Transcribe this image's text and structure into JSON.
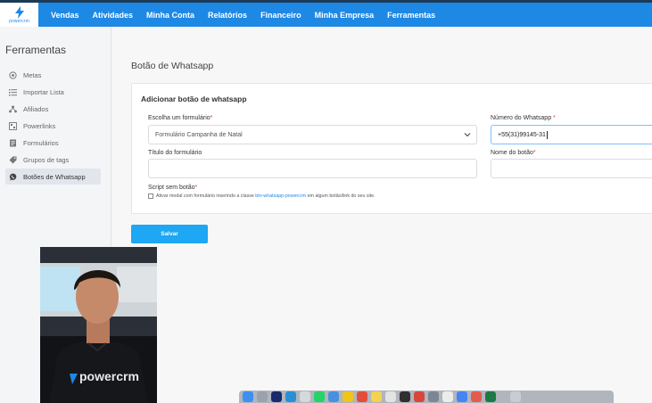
{
  "brand": {
    "logo_text": "powercrm"
  },
  "nav": [
    "Vendas",
    "Atividades",
    "Minha Conta",
    "Relatórios",
    "Financeiro",
    "Minha Empresa",
    "Ferramentas"
  ],
  "sidebar": {
    "title": "Ferramentas",
    "items": [
      {
        "label": "Metas",
        "icon": "target-icon",
        "active": false
      },
      {
        "label": "Importar Lista",
        "icon": "list-icon",
        "active": false
      },
      {
        "label": "Afiliados",
        "icon": "affiliates-icon",
        "active": false
      },
      {
        "label": "Powerlinks",
        "icon": "link-icon",
        "active": false
      },
      {
        "label": "Formulários",
        "icon": "form-icon",
        "active": false
      },
      {
        "label": "Grupos de tags",
        "icon": "tag-icon",
        "active": false
      },
      {
        "label": "Botões de Whatsapp",
        "icon": "whatsapp-icon",
        "active": true
      }
    ]
  },
  "page": {
    "title": "Botão de Whatsapp",
    "card_title": "Adicionar botão de whatsapp",
    "form": {
      "form_select_label": "Escolha um formulário",
      "form_select_value": "Formulário Campanha de Natal",
      "whatsapp_label": "Número do Whatsapp",
      "whatsapp_value": "+55(31)99145-31",
      "form_title_label": "Título do formulário",
      "form_title_value": "",
      "button_name_label": "Nome do botão",
      "button_name_value": "",
      "script_label": "Script sem botão",
      "script_text_before": "Ativar modal com formulário inserindo a classe",
      "script_code": "btn-whatsapp-powercrm",
      "script_text_after": "em algum botão/link do seu site.",
      "required_mark": "*"
    },
    "save_label": "Salvar"
  },
  "webcam": {
    "shirt_text": "powercrm"
  },
  "colors": {
    "topbar": "#1e88e5",
    "accent": "#1ea7f2",
    "required": "#e53935"
  }
}
